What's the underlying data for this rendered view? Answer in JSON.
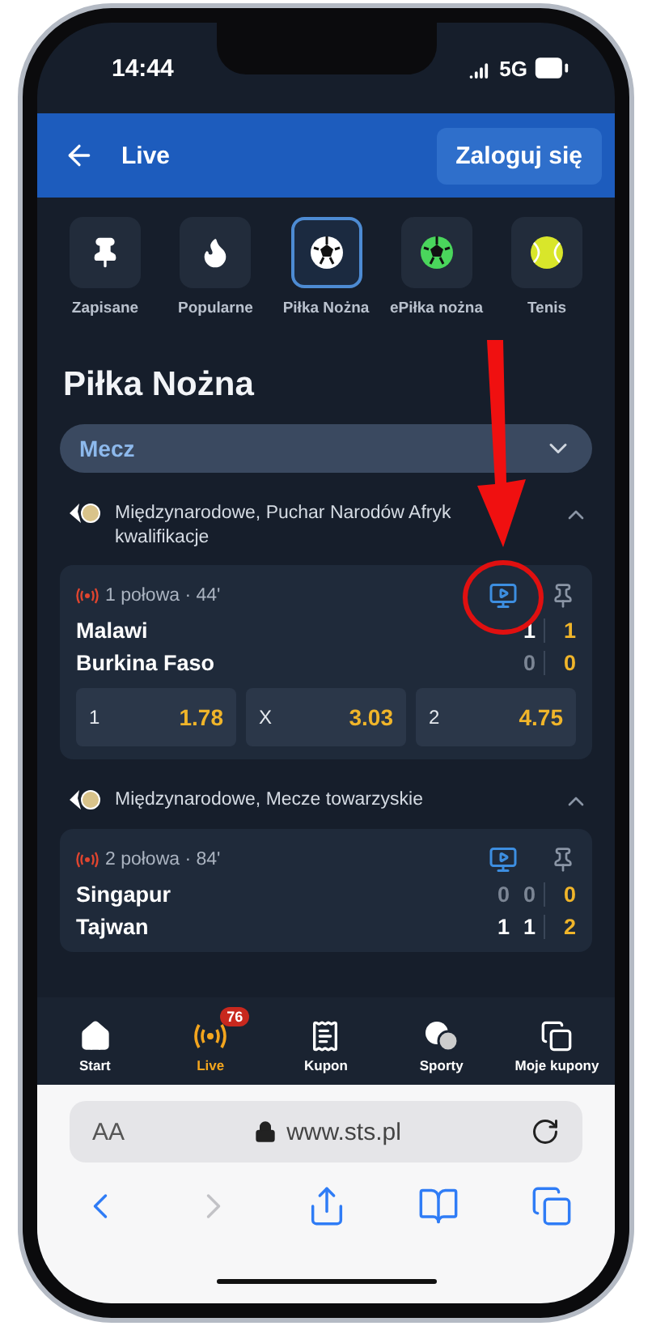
{
  "status_bar": {
    "time": "14:44",
    "network": "5G"
  },
  "header": {
    "title": "Live",
    "login_button": "Zaloguj się"
  },
  "categories": [
    {
      "label": "Zapisane",
      "kind": "pin",
      "selected": false
    },
    {
      "label": "Popularne",
      "kind": "flame",
      "selected": false
    },
    {
      "label": "Piłka Nożna",
      "kind": "ball",
      "selected": true
    },
    {
      "label": "ePiłka nożna",
      "kind": "eball",
      "selected": false
    },
    {
      "label": "Tenis",
      "kind": "tennis",
      "selected": false
    }
  ],
  "section_title": "Piłka Nożna",
  "filter": {
    "value": "Mecz"
  },
  "groups": [
    {
      "title": "Międzynarodowe, Puchar Narodów Afryk kwalifikacje",
      "expanded": true,
      "matches": [
        {
          "period": "1 połowa · 44'",
          "teams": [
            {
              "name": "Malawi",
              "scores": [
                "1"
              ],
              "total": "1",
              "leading": true
            },
            {
              "name": "Burkina Faso",
              "scores": [
                "0"
              ],
              "total": "0",
              "leading": false
            }
          ],
          "odds": [
            {
              "label": "1",
              "value": "1.78"
            },
            {
              "label": "X",
              "value": "3.03"
            },
            {
              "label": "2",
              "value": "4.75"
            }
          ]
        }
      ]
    },
    {
      "title": "Międzynarodowe, Mecze towarzyskie",
      "expanded": true,
      "matches": [
        {
          "period": "2 połowa · 84'",
          "teams": [
            {
              "name": "Singapur",
              "scores": [
                "0",
                "0"
              ],
              "total": "0",
              "leading": false
            },
            {
              "name": "Tajwan",
              "scores": [
                "1",
                "1"
              ],
              "total": "2",
              "leading": true
            }
          ]
        }
      ]
    }
  ],
  "bottom_nav": [
    {
      "label": "Start",
      "kind": "home",
      "selected": false
    },
    {
      "label": "Live",
      "kind": "live",
      "selected": true,
      "badge": "76"
    },
    {
      "label": "Kupon",
      "kind": "coupon",
      "selected": false
    },
    {
      "label": "Sporty",
      "kind": "sports",
      "selected": false
    },
    {
      "label": "Moje kupony",
      "kind": "coupons",
      "selected": false
    }
  ],
  "browser": {
    "text_size": "AA",
    "url": "www.sts.pl",
    "toolbar": [
      {
        "kind": "back",
        "disabled": false
      },
      {
        "kind": "forward",
        "disabled": true
      },
      {
        "kind": "share",
        "disabled": false
      },
      {
        "kind": "bookmarks",
        "disabled": false
      },
      {
        "kind": "tabs",
        "disabled": false
      }
    ]
  }
}
